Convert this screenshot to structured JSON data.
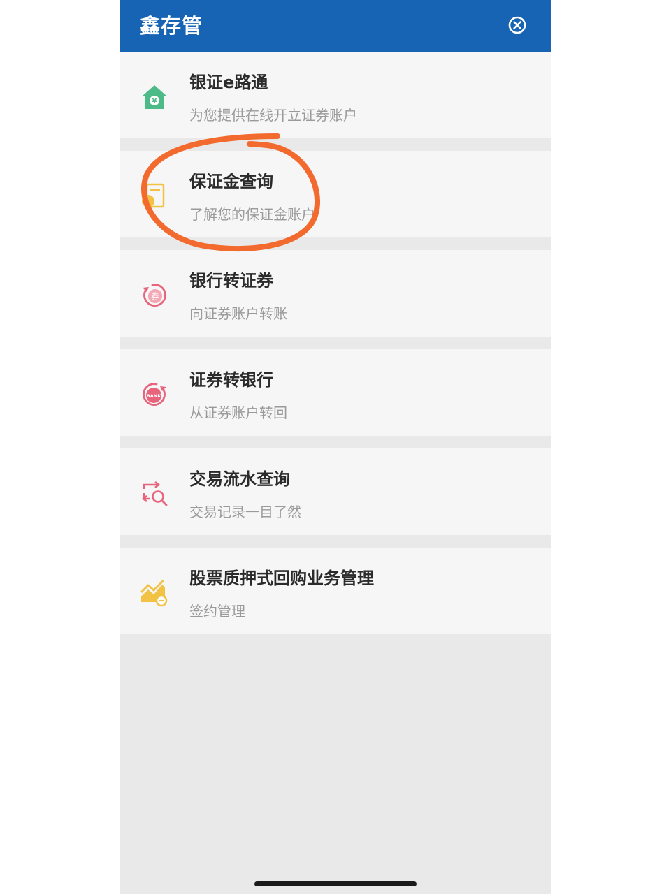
{
  "header": {
    "title": "鑫存管",
    "close_icon": "close-circle-icon"
  },
  "menu": [
    {
      "title": "银证e路通",
      "subtitle": "为您提供在线开立证券账户",
      "icon": "house-yuan-icon",
      "icon_color": "#4cbb87"
    },
    {
      "title": "保证金查询",
      "subtitle": "了解您的保证金账户",
      "icon": "document-coin-icon",
      "icon_color": "#f2c244"
    },
    {
      "title": "银行转证券",
      "subtitle": "向证券账户转账",
      "icon": "coupon-transfer-icon",
      "icon_color": "#e8647c"
    },
    {
      "title": "证券转银行",
      "subtitle": "从证券账户转回",
      "icon": "bank-transfer-icon",
      "icon_color": "#e8647c"
    },
    {
      "title": "交易流水查询",
      "subtitle": "交易记录一目了然",
      "icon": "transaction-search-icon",
      "icon_color": "#e8647c"
    },
    {
      "title": "股票质押式回购业务管理",
      "subtitle": "签约管理",
      "icon": "stock-chart-icon",
      "icon_color": "#f2c244"
    }
  ],
  "icon_glyphs": {
    "coupon": "券",
    "bank": "BANK"
  },
  "colors": {
    "header_bg": "#1664b3",
    "annotation": "#f26a2e"
  }
}
